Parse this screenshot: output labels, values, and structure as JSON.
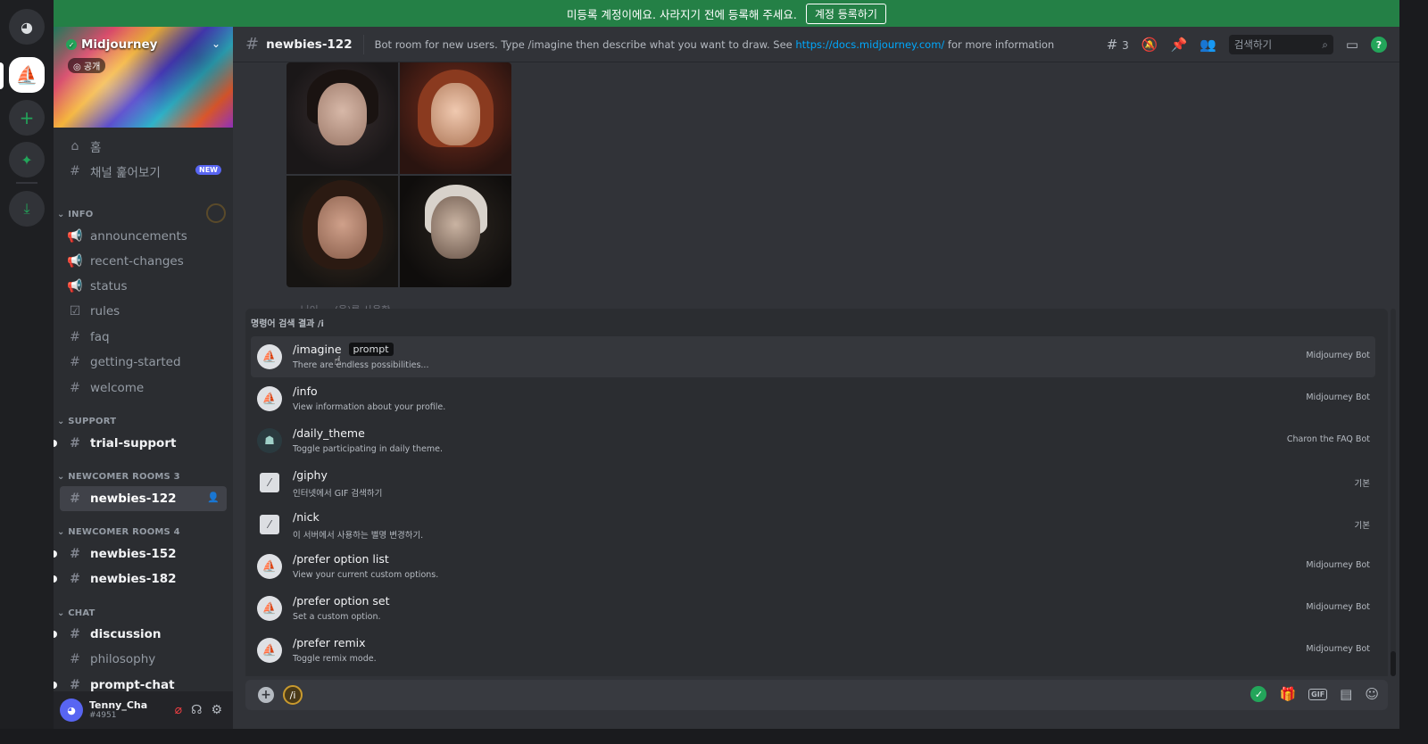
{
  "banner": {
    "text": "미등록 계정이에요. 사라지기 전에 등록해 주세요.",
    "button": "계정 등록하기"
  },
  "guild": {
    "name": "Midjourney",
    "visibility": "공개"
  },
  "nav": {
    "home": "홈",
    "browse": "채널 훑어보기",
    "new_badge": "NEW"
  },
  "categories": {
    "info": "INFO",
    "support": "SUPPORT",
    "newcomer3": "NEWCOMER ROOMS 3",
    "newcomer4": "NEWCOMER ROOMS 4",
    "chat": "CHAT"
  },
  "channels": {
    "announcements": "announcements",
    "recent_changes": "recent-changes",
    "status": "status",
    "rules": "rules",
    "faq": "faq",
    "getting_started": "getting-started",
    "welcome": "welcome",
    "trial_support": "trial-support",
    "newbies_122": "newbies-122",
    "newbies_152": "newbies-152",
    "newbies_182": "newbies-182",
    "discussion": "discussion",
    "philosophy": "philosophy",
    "prompt_chat": "prompt-chat"
  },
  "user": {
    "name": "Tenny_Cha",
    "tag": "#4951"
  },
  "header": {
    "channel": "newbies-122",
    "topic_pre": "Bot room for new users. Type /imagine then describe what you want to draw. See ",
    "topic_link": "https://docs.midjourney.com/",
    "topic_post": " for more information",
    "threads": "3",
    "search_placeholder": "검색하기"
  },
  "hidden_line": "… 님이 … (을)를 사용함",
  "autocomplete": {
    "heading": "명령어 검색 결과 /i",
    "items": [
      {
        "name": "/imagine",
        "option": "prompt",
        "desc": "There are endless possibilities...",
        "source": "Midjourney Bot"
      },
      {
        "name": "/info",
        "desc": "View information about your profile.",
        "source": "Midjourney Bot"
      },
      {
        "name": "/daily_theme",
        "desc": "Toggle participating in daily theme.",
        "source": "Charon the FAQ Bot"
      },
      {
        "name": "/giphy",
        "desc": "인터넷에서 GIF 검색하기",
        "source": "기본"
      },
      {
        "name": "/nick",
        "desc": "이 서버에서 사용하는 별명 변경하기.",
        "source": "기본"
      },
      {
        "name": "/prefer option list",
        "desc": "View your current custom options.",
        "source": "Midjourney Bot"
      },
      {
        "name": "/prefer option set",
        "desc": "Set a custom option.",
        "source": "Midjourney Bot"
      },
      {
        "name": "/prefer remix",
        "desc": "Toggle remix mode.",
        "source": "Midjourney Bot"
      }
    ]
  },
  "composer": {
    "value": "/i",
    "gif_label": "GIF"
  },
  "icons": {
    "discord": "discord-icon",
    "midjourney": "sailboat-icon",
    "add_server": "plus-icon",
    "explore": "compass-icon",
    "download": "download-icon",
    "hash": "hash-icon"
  }
}
